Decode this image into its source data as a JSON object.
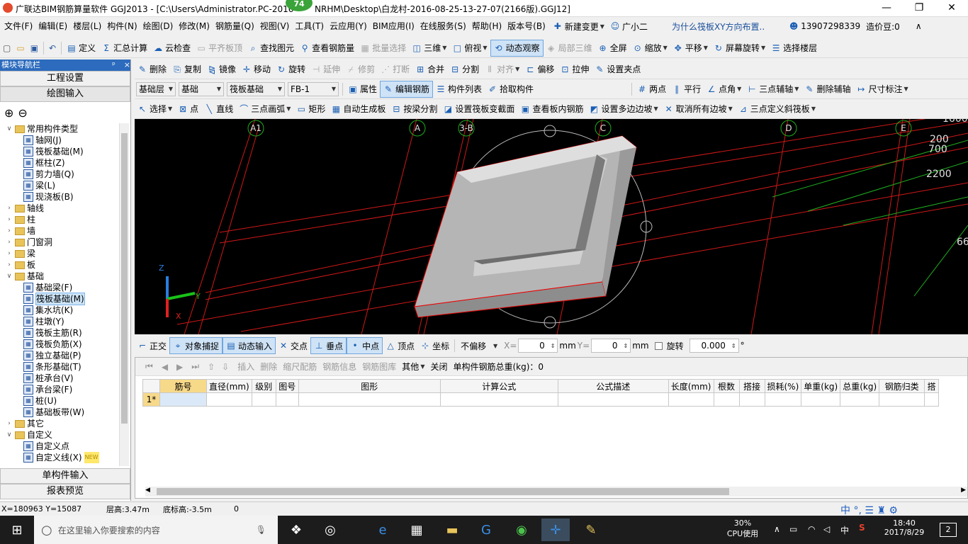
{
  "window": {
    "title": "广联达BIM钢筋算量软件 GGJ2013 - [C:\\Users\\Administrator.PC-2016",
    "title_suffix": "NRHM\\Desktop\\白龙村-2016-08-25-13-27-07(2166版).GGJ12]",
    "badge": "74",
    "minimize": "—",
    "restore": "❐",
    "close": "✕"
  },
  "menubar": {
    "items": [
      "文件(F)",
      "编辑(E)",
      "楼层(L)",
      "构件(N)",
      "绘图(D)",
      "修改(M)",
      "钢筋量(Q)",
      "视图(V)",
      "工具(T)",
      "云应用(Y)",
      "BIM应用(I)",
      "在线服务(S)",
      "帮助(H)",
      "版本号(B)"
    ],
    "new_change": "新建变更",
    "assistant": "广小二",
    "question": "为什么筏板XY方向布置..",
    "phone": "13907298339",
    "price_bean": "造价豆:0",
    "extra": "∧"
  },
  "toolbar1": {
    "items": [
      {
        "label": "定义",
        "icon": "define-icon",
        "glyph": "▤"
      },
      {
        "label": "汇总计算",
        "icon": "sigma-icon",
        "glyph": "Σ"
      },
      {
        "label": "云检查",
        "icon": "cloud-check-icon",
        "glyph": "☁"
      },
      {
        "label": "平齐板顶",
        "icon": "flush-slab-icon",
        "glyph": "▭",
        "disabled": true
      },
      {
        "label": "查找图元",
        "icon": "find-icon",
        "glyph": "⌕"
      },
      {
        "label": "查看钢筋量",
        "icon": "view-rebar-icon",
        "glyph": "⚲"
      },
      {
        "label": "批量选择",
        "icon": "batch-select-icon",
        "glyph": "▦",
        "disabled": true
      },
      {
        "label": "三维",
        "icon": "3d-icon",
        "glyph": "◫",
        "dropdown": true
      },
      {
        "label": "俯视",
        "icon": "top-view-icon",
        "glyph": "□",
        "dropdown": true
      },
      {
        "label": "动态观察",
        "icon": "orbit-icon",
        "glyph": "⟲",
        "active": true
      },
      {
        "label": "局部三维",
        "icon": "local-3d-icon",
        "glyph": "◈",
        "disabled": true
      },
      {
        "label": "全屏",
        "icon": "fullscreen-icon",
        "glyph": "⊕"
      },
      {
        "label": "缩放",
        "icon": "zoom-icon",
        "glyph": "⊙",
        "dropdown": true
      },
      {
        "label": "平移",
        "icon": "pan-icon",
        "glyph": "✥",
        "dropdown": true
      },
      {
        "label": "屏幕旋转",
        "icon": "screen-rotate-icon",
        "glyph": "↻",
        "dropdown": true
      },
      {
        "label": "选择楼层",
        "icon": "select-floor-icon",
        "glyph": "☰"
      }
    ]
  },
  "toolbar2": {
    "items": [
      {
        "label": "删除",
        "icon": "delete-icon",
        "glyph": "✎"
      },
      {
        "label": "复制",
        "icon": "copy-icon",
        "glyph": "⎘"
      },
      {
        "label": "镜像",
        "icon": "mirror-icon",
        "glyph": "⧎"
      },
      {
        "label": "移动",
        "icon": "move-icon",
        "glyph": "✛"
      },
      {
        "label": "旋转",
        "icon": "rotate-icon",
        "glyph": "↻"
      },
      {
        "label": "延伸",
        "icon": "extend-icon",
        "glyph": "⊣",
        "disabled": true
      },
      {
        "label": "修剪",
        "icon": "trim-icon",
        "glyph": "⌿",
        "disabled": true
      },
      {
        "label": "打断",
        "icon": "break-icon",
        "glyph": "⋰",
        "disabled": true
      },
      {
        "label": "合并",
        "icon": "merge-icon",
        "glyph": "⊞"
      },
      {
        "label": "分割",
        "icon": "split-icon",
        "glyph": "⊟"
      },
      {
        "label": "对齐",
        "icon": "align-icon",
        "glyph": "⫴",
        "disabled": true,
        "dropdown": true
      },
      {
        "label": "偏移",
        "icon": "offset-icon",
        "glyph": "⊏"
      },
      {
        "label": "拉伸",
        "icon": "stretch-icon",
        "glyph": "⊡"
      },
      {
        "label": "设置夹点",
        "icon": "grip-icon",
        "glyph": "✎"
      }
    ]
  },
  "toolbar3": {
    "floor": "基础层",
    "category": "基础",
    "component_type": "筏板基础",
    "component": "FB-1",
    "items": [
      {
        "label": "属性",
        "icon": "properties-icon",
        "glyph": "▣"
      },
      {
        "label": "编辑钢筋",
        "icon": "edit-rebar-icon",
        "glyph": "✎",
        "active": true
      },
      {
        "label": "构件列表",
        "icon": "component-list-icon",
        "glyph": "☰"
      },
      {
        "label": "拾取构件",
        "icon": "pick-icon",
        "glyph": "✐"
      }
    ],
    "right_items": [
      {
        "label": "两点",
        "icon": "two-point-icon",
        "glyph": "#"
      },
      {
        "label": "平行",
        "icon": "parallel-icon",
        "glyph": "∥"
      },
      {
        "label": "点角",
        "icon": "point-angle-icon",
        "glyph": "∠",
        "dropdown": true
      },
      {
        "label": "三点辅轴",
        "icon": "three-point-axis-icon",
        "glyph": "⊢",
        "dropdown": true
      },
      {
        "label": "删除辅轴",
        "icon": "delete-axis-icon",
        "glyph": "✎"
      },
      {
        "label": "尺寸标注",
        "icon": "dimension-icon",
        "glyph": "↦",
        "dropdown": true
      }
    ]
  },
  "toolbar4": {
    "items": [
      {
        "label": "选择",
        "icon": "select-icon",
        "glyph": "↖",
        "dropdown": true
      },
      {
        "label": "点",
        "icon": "point-icon",
        "glyph": "⊠"
      },
      {
        "label": "直线",
        "icon": "line-icon",
        "glyph": "╲"
      },
      {
        "label": "三点画弧",
        "icon": "arc-icon",
        "glyph": "⌒",
        "dropdown": true
      },
      {
        "label": "矩形",
        "icon": "rectangle-icon",
        "glyph": "▭"
      },
      {
        "label": "自动生成板",
        "icon": "auto-slab-icon",
        "glyph": "▦"
      },
      {
        "label": "按梁分割",
        "icon": "beam-split-icon",
        "glyph": "⊟"
      },
      {
        "label": "设置筏板变截面",
        "icon": "variable-section-icon",
        "glyph": "◪"
      },
      {
        "label": "查看板内钢筋",
        "icon": "view-slab-rebar-icon",
        "glyph": "▣"
      },
      {
        "label": "设置多边边坡",
        "icon": "slope-icon",
        "glyph": "◩",
        "dropdown": true
      },
      {
        "label": "取消所有边坡",
        "icon": "cancel-slope-icon",
        "glyph": "✕",
        "dropdown": true
      },
      {
        "label": "三点定义斜筏板",
        "icon": "sloped-raft-icon",
        "glyph": "⊿",
        "dropdown": true
      }
    ]
  },
  "left_panel": {
    "header": "模块导航栏",
    "pin": "ᵖ",
    "close": "×",
    "project_settings": "工程设置",
    "drawing_input": "绘图输入",
    "single_component_input": "单构件输入",
    "report_preview": "报表预览",
    "tree": [
      {
        "label": "常用构件类型",
        "level": 0,
        "type": "folder",
        "expanded": true
      },
      {
        "label": "轴网(J)",
        "level": 1,
        "type": "item"
      },
      {
        "label": "筏板基础(M)",
        "level": 1,
        "type": "item"
      },
      {
        "label": "框柱(Z)",
        "level": 1,
        "type": "item"
      },
      {
        "label": "剪力墙(Q)",
        "level": 1,
        "type": "item"
      },
      {
        "label": "梁(L)",
        "level": 1,
        "type": "item"
      },
      {
        "label": "现浇板(B)",
        "level": 1,
        "type": "item"
      },
      {
        "label": "轴线",
        "level": 0,
        "type": "folder",
        "expanded": false
      },
      {
        "label": "柱",
        "level": 0,
        "type": "folder",
        "expanded": false
      },
      {
        "label": "墙",
        "level": 0,
        "type": "folder",
        "expanded": false
      },
      {
        "label": "门窗洞",
        "level": 0,
        "type": "folder",
        "expanded": false
      },
      {
        "label": "梁",
        "level": 0,
        "type": "folder",
        "expanded": false
      },
      {
        "label": "板",
        "level": 0,
        "type": "folder",
        "expanded": false
      },
      {
        "label": "基础",
        "level": 0,
        "type": "folder",
        "expanded": true
      },
      {
        "label": "基础梁(F)",
        "level": 1,
        "type": "item"
      },
      {
        "label": "筏板基础(M)",
        "level": 1,
        "type": "item",
        "selected": true
      },
      {
        "label": "集水坑(K)",
        "level": 1,
        "type": "item"
      },
      {
        "label": "柱墩(Y)",
        "level": 1,
        "type": "item"
      },
      {
        "label": "筏板主筋(R)",
        "level": 1,
        "type": "item"
      },
      {
        "label": "筏板负筋(X)",
        "level": 1,
        "type": "item"
      },
      {
        "label": "独立基础(P)",
        "level": 1,
        "type": "item"
      },
      {
        "label": "条形基础(T)",
        "level": 1,
        "type": "item"
      },
      {
        "label": "桩承台(V)",
        "level": 1,
        "type": "item"
      },
      {
        "label": "承台梁(F)",
        "level": 1,
        "type": "item"
      },
      {
        "label": "桩(U)",
        "level": 1,
        "type": "item"
      },
      {
        "label": "基础板带(W)",
        "level": 1,
        "type": "item"
      },
      {
        "label": "其它",
        "level": 0,
        "type": "folder",
        "expanded": false
      },
      {
        "label": "自定义",
        "level": 0,
        "type": "folder",
        "expanded": true
      },
      {
        "label": "自定义点",
        "level": 1,
        "type": "item"
      },
      {
        "label": "自定义线(X)",
        "level": 1,
        "type": "item",
        "badge": "NEW"
      }
    ]
  },
  "viewport": {
    "axes": [
      "A1",
      "A",
      "3-B",
      "C",
      "D",
      "E"
    ],
    "dims": [
      "1600",
      "200",
      "700",
      "2200",
      "66"
    ],
    "axis_labels": {
      "x": "X",
      "y": "Y",
      "z": "Z"
    }
  },
  "snapbar": {
    "items": [
      {
        "label": "正交",
        "icon": "ortho-icon",
        "glyph": "⌐"
      },
      {
        "label": "对象捕捉",
        "icon": "object-snap-icon",
        "glyph": "⌖",
        "active": true
      },
      {
        "label": "动态输入",
        "icon": "dynamic-input-icon",
        "glyph": "▤",
        "active": true
      },
      {
        "label": "交点",
        "icon": "intersection-icon",
        "glyph": "✕"
      },
      {
        "label": "垂点",
        "icon": "perpendicular-icon",
        "glyph": "⊥",
        "active": true
      },
      {
        "label": "中点",
        "icon": "midpoint-icon",
        "glyph": "•",
        "active": true
      },
      {
        "label": "顶点",
        "icon": "vertex-icon",
        "glyph": "△"
      },
      {
        "label": "坐标",
        "icon": "coordinate-icon",
        "glyph": "⊹"
      }
    ],
    "offset_mode": "不偏移",
    "x_label": "X=",
    "x_value": "0",
    "y_label": "Y=",
    "y_value": "0",
    "unit": "mm",
    "rotate_label": "旋转",
    "rotate_value": "0.000",
    "degree": "°"
  },
  "rebar_toolbar": {
    "items": [
      {
        "label": "插入",
        "disabled": true
      },
      {
        "label": "删除",
        "disabled": true
      },
      {
        "label": "缩尺配筋",
        "disabled": true
      },
      {
        "label": "钢筋信息",
        "disabled": true
      },
      {
        "label": "钢筋图库",
        "disabled": true
      },
      {
        "label": "其他",
        "dropdown": true
      },
      {
        "label": "关闭"
      }
    ],
    "total_weight_label": "单构件钢筋总重(kg)：0"
  },
  "rebar_table": {
    "columns": [
      "筋号",
      "直径(mm)",
      "级别",
      "图号",
      "图形",
      "计算公式",
      "公式描述",
      "长度(mm)",
      "根数",
      "搭接",
      "损耗(%)",
      "单重(kg)",
      "总重(kg)",
      "钢筋归类",
      "搭"
    ],
    "rows": [
      {
        "index": "1*",
        "cells": [
          "",
          "",
          "",
          "",
          "",
          "",
          "",
          "",
          "",
          "",
          "",
          "",
          "",
          "",
          ""
        ]
      }
    ]
  },
  "statusbar": {
    "coords": "X=180963 Y=15087",
    "floor_height": "层高:3.47m",
    "bottom_elevation": "底标高:-3.5m",
    "value": "0",
    "ime": "中 °, ☰ ♜ ⚙"
  },
  "taskbar": {
    "search_placeholder": "在这里输入你要搜索的内容",
    "cpu_percent": "30%",
    "cpu_label": "CPU使用",
    "lang": "中",
    "time": "18:40",
    "date": "2017/8/29",
    "notif": "2"
  }
}
